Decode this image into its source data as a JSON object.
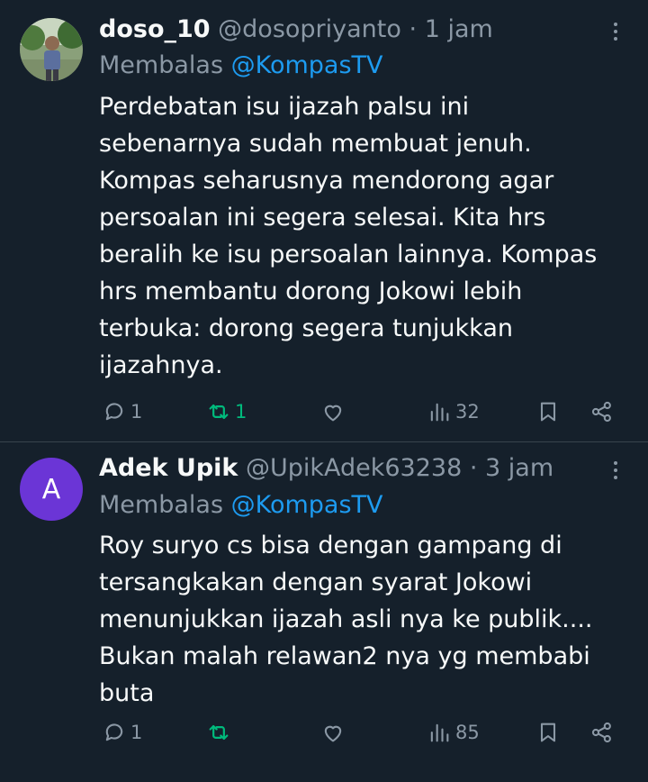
{
  "tweets": [
    {
      "display_name": "doso_10",
      "handle": "@dosopriyanto",
      "separator": "·",
      "time": "1 jam",
      "reply_prefix": "Membalas ",
      "reply_to": "@KompasTV",
      "avatar": "photo",
      "lines": [
        "Perdebatan isu ijazah palsu ini",
        "sebenarnya sudah membuat jenuh.",
        "Kompas seharusnya mendorong agar",
        "persoalan ini segera selesai. Kita hrs",
        "beralih ke isu persoalan lainnya. Kompas",
        "hrs membantu dorong Jokowi lebih",
        "terbuka: dorong segera tunjukkan",
        "ijazahnya."
      ],
      "replies": "1",
      "reposts": "1",
      "likes": "",
      "views": "32"
    },
    {
      "display_name": "Adek Upik",
      "handle": "@UpikAdek63238",
      "separator": "·",
      "time": "3 jam",
      "reply_prefix": "Membalas ",
      "reply_to": "@KompasTV",
      "avatar_letter": "A",
      "avatar_color": "#6b35d6",
      "lines": [
        "Roy suryo cs bisa dengan gampang di",
        "tersangkakan dengan syarat Jokowi",
        "menunjukkan ijazah asli nya ke publik....",
        "Bukan malah relawan2 nya yg membabi",
        "buta"
      ],
      "replies": "1",
      "reposts": "",
      "likes": "",
      "views": "85"
    }
  ],
  "colors": {
    "background": "#15202b",
    "text": "#f7f9f9",
    "muted": "#8b98a5",
    "link": "#1d9bf0",
    "repost_active": "#00ba7c"
  },
  "icons": [
    "more-icon",
    "reply-icon",
    "repost-icon",
    "like-icon",
    "views-icon",
    "bookmark-icon",
    "share-icon"
  ]
}
